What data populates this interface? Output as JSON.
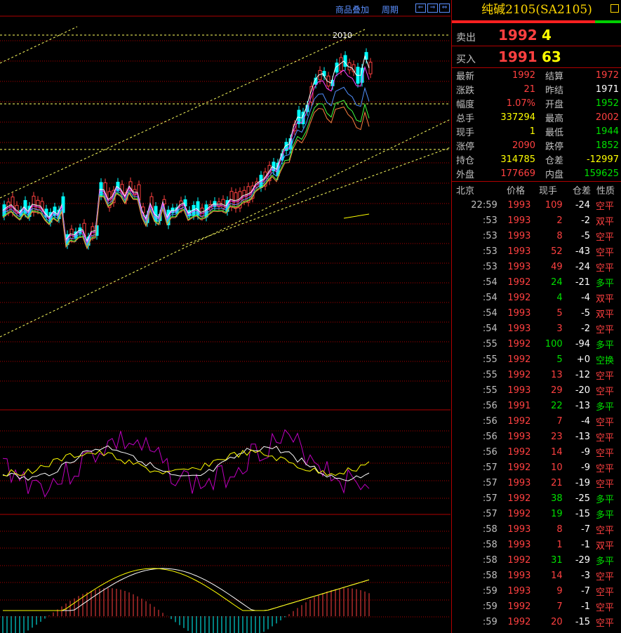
{
  "toolbar": {
    "overlay_label": "商品叠加",
    "period_label": "周期"
  },
  "title": "纯碱2105(SA2105)",
  "chart_annotation": "2010",
  "quotes": {
    "sell": {
      "label": "卖出",
      "price": "1992",
      "volume": "4"
    },
    "buy": {
      "label": "买入",
      "price": "1991",
      "volume": "63"
    }
  },
  "stats": [
    {
      "k1": "最新",
      "v1": "1992",
      "c1": "red",
      "k2": "结算",
      "v2": "1972",
      "c2": "red"
    },
    {
      "k1": "涨跌",
      "v1": "21",
      "c1": "red",
      "k2": "昨结",
      "v2": "1971",
      "c2": "white"
    },
    {
      "k1": "幅度",
      "v1": "1.07%",
      "c1": "red",
      "k2": "开盘",
      "v2": "1952",
      "c2": "green"
    },
    {
      "k1": "总手",
      "v1": "337294",
      "c1": "yellow",
      "k2": "最高",
      "v2": "2002",
      "c2": "red"
    },
    {
      "k1": "现手",
      "v1": "1",
      "c1": "yellow",
      "k2": "最低",
      "v2": "1944",
      "c2": "green"
    },
    {
      "k1": "涨停",
      "v1": "2090",
      "c1": "red",
      "k2": "跌停",
      "v2": "1852",
      "c2": "green"
    },
    {
      "k1": "持仓",
      "v1": "314785",
      "c1": "yellow",
      "k2": "仓差",
      "v2": "-12997",
      "c2": "yellow"
    },
    {
      "k1": "外盘",
      "v1": "177669",
      "c1": "red",
      "k2": "内盘",
      "v2": "159625",
      "c2": "green"
    }
  ],
  "ticks_header": {
    "time": "北京",
    "price": "价格",
    "volume": "现手",
    "oi_change": "仓差",
    "nature": "性质"
  },
  "ticks": [
    {
      "time": "22:59",
      "price": "1993",
      "vol": "109",
      "vc": "red",
      "oi": "-24",
      "nature": "空平",
      "nc": "red"
    },
    {
      "time": ":53",
      "price": "1993",
      "vol": "2",
      "vc": "red",
      "oi": "-2",
      "nature": "双平",
      "nc": "red"
    },
    {
      "time": ":53",
      "price": "1993",
      "vol": "8",
      "vc": "red",
      "oi": "-5",
      "nature": "空平",
      "nc": "red"
    },
    {
      "time": ":53",
      "price": "1993",
      "vol": "52",
      "vc": "red",
      "oi": "-43",
      "nature": "空平",
      "nc": "red"
    },
    {
      "time": ":53",
      "price": "1993",
      "vol": "49",
      "vc": "red",
      "oi": "-24",
      "nature": "空平",
      "nc": "red"
    },
    {
      "time": ":54",
      "price": "1992",
      "vol": "24",
      "vc": "green",
      "oi": "-21",
      "nature": "多平",
      "nc": "green"
    },
    {
      "time": ":54",
      "price": "1992",
      "vol": "4",
      "vc": "green",
      "oi": "-4",
      "nature": "双平",
      "nc": "red"
    },
    {
      "time": ":54",
      "price": "1993",
      "vol": "5",
      "vc": "red",
      "oi": "-5",
      "nature": "双平",
      "nc": "red"
    },
    {
      "time": ":54",
      "price": "1993",
      "vol": "3",
      "vc": "red",
      "oi": "-2",
      "nature": "空平",
      "nc": "red"
    },
    {
      "time": ":55",
      "price": "1992",
      "vol": "100",
      "vc": "green",
      "oi": "-94",
      "nature": "多平",
      "nc": "green"
    },
    {
      "time": ":55",
      "price": "1992",
      "vol": "5",
      "vc": "green",
      "oi": "+0",
      "nature": "空换",
      "nc": "green"
    },
    {
      "time": ":55",
      "price": "1992",
      "vol": "13",
      "vc": "red",
      "oi": "-12",
      "nature": "空平",
      "nc": "red"
    },
    {
      "time": ":55",
      "price": "1993",
      "vol": "29",
      "vc": "red",
      "oi": "-20",
      "nature": "空平",
      "nc": "red"
    },
    {
      "time": ":56",
      "price": "1991",
      "vol": "22",
      "vc": "green",
      "oi": "-13",
      "nature": "多平",
      "nc": "green"
    },
    {
      "time": ":56",
      "price": "1992",
      "vol": "7",
      "vc": "red",
      "oi": "-4",
      "nature": "空平",
      "nc": "red"
    },
    {
      "time": ":56",
      "price": "1993",
      "vol": "23",
      "vc": "red",
      "oi": "-13",
      "nature": "空平",
      "nc": "red"
    },
    {
      "time": ":56",
      "price": "1992",
      "vol": "14",
      "vc": "red",
      "oi": "-9",
      "nature": "空平",
      "nc": "red"
    },
    {
      "time": ":57",
      "price": "1992",
      "vol": "10",
      "vc": "red",
      "oi": "-9",
      "nature": "空平",
      "nc": "red"
    },
    {
      "time": ":57",
      "price": "1993",
      "vol": "21",
      "vc": "red",
      "oi": "-19",
      "nature": "空平",
      "nc": "red"
    },
    {
      "time": ":57",
      "price": "1992",
      "vol": "38",
      "vc": "green",
      "oi": "-25",
      "nature": "多平",
      "nc": "green"
    },
    {
      "time": ":57",
      "price": "1992",
      "vol": "19",
      "vc": "green",
      "oi": "-15",
      "nature": "多平",
      "nc": "green"
    },
    {
      "time": ":58",
      "price": "1993",
      "vol": "8",
      "vc": "red",
      "oi": "-7",
      "nature": "空平",
      "nc": "red"
    },
    {
      "time": ":58",
      "price": "1993",
      "vol": "1",
      "vc": "red",
      "oi": "-1",
      "nature": "双平",
      "nc": "red"
    },
    {
      "time": ":58",
      "price": "1992",
      "vol": "31",
      "vc": "green",
      "oi": "-29",
      "nature": "多平",
      "nc": "green"
    },
    {
      "time": ":58",
      "price": "1993",
      "vol": "14",
      "vc": "red",
      "oi": "-3",
      "nature": "空平",
      "nc": "red"
    },
    {
      "time": ":59",
      "price": "1993",
      "vol": "9",
      "vc": "red",
      "oi": "-7",
      "nature": "空平",
      "nc": "red"
    },
    {
      "time": ":59",
      "price": "1992",
      "vol": "7",
      "vc": "red",
      "oi": "-1",
      "nature": "空平",
      "nc": "red"
    },
    {
      "time": ":59",
      "price": "1992",
      "vol": "20",
      "vc": "red",
      "oi": "-15",
      "nature": "空平",
      "nc": "red"
    }
  ],
  "colors": {
    "up": "#ff4040",
    "down": "#00ffff",
    "accent": "#ffd700",
    "grid": "#b00000"
  }
}
